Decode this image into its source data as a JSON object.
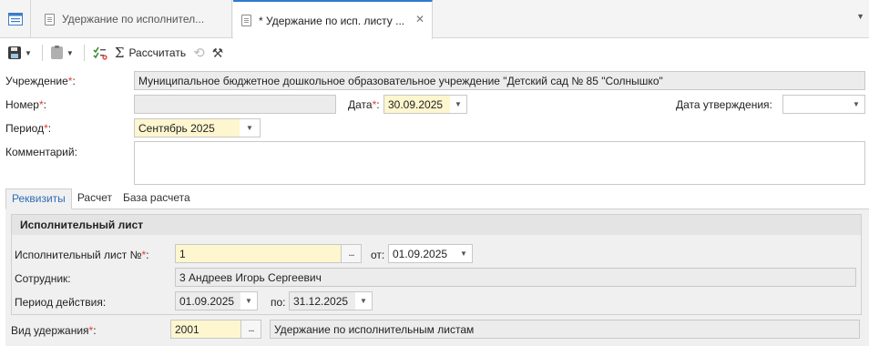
{
  "tabs": {
    "tab1_label": "Удержание по исполнител...",
    "tab2_label": "* Удержание по исп. листу ..."
  },
  "toolbar": {
    "calculate_label": "Рассчитать"
  },
  "form": {
    "institution_label": "Учреждение",
    "institution_value": "Муниципальное бюджетное дошкольное образовательное учреждение \"Детский сад № 85 \"Солнышко\"",
    "number_label": "Номер",
    "number_value": "",
    "date_label": "Дата",
    "date_value": "30.09.2025",
    "approval_date_label": "Дата утверждения:",
    "approval_date_value": "",
    "period_label": "Период",
    "period_value": "Сентябрь 2025",
    "comment_label": "Комментарий:",
    "comment_value": ""
  },
  "inner_tabs": [
    "Реквизиты",
    "Расчет",
    "База расчета"
  ],
  "group": {
    "title": "Исполнительный лист",
    "writ_no_label": "Исполнительный лист №",
    "writ_no_value": "1",
    "from_label": "от:",
    "from_value": "01.09.2025",
    "employee_label": "Сотрудник:",
    "employee_value": "3 Андреев Игорь Сергеевич",
    "validity_label": "Период действия:",
    "validity_from": "01.09.2025",
    "to_label": "по:",
    "validity_to": "31.12.2025"
  },
  "deduction": {
    "label": "Вид удержания",
    "code": "2001",
    "name": "Удержание по исполнительным листам"
  },
  "colors": {
    "accent": "#2f7bd0",
    "required": "#e53935",
    "highlight": "#fdf6cf"
  }
}
